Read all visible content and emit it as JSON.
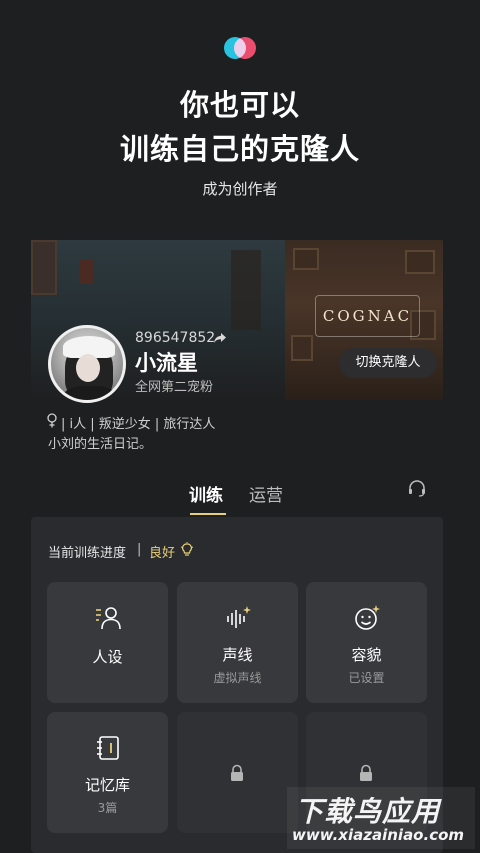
{
  "header": {
    "headline_line1": "你也可以",
    "headline_line2": "训练自己的克隆人",
    "subline": "成为创作者"
  },
  "profile": {
    "uid": "896547852",
    "nickname": "小流星",
    "subtitle": "全网第二宠粉",
    "tags": "| i人 | 叛逆少女 | 旅行达人",
    "bio": "小刘的生活日记。",
    "switch_label": "切换克隆人",
    "banner_sign": "COGNAC"
  },
  "tabs": [
    {
      "label": "训练",
      "active": true
    },
    {
      "label": "运营",
      "active": false
    }
  ],
  "progress": {
    "label": "当前训练进度",
    "separator": "|",
    "value": "良好"
  },
  "tiles": [
    {
      "label": "人设",
      "sub": "",
      "icon": "persona-icon",
      "locked": false
    },
    {
      "label": "声线",
      "sub": "虚拟声线",
      "icon": "voice-wave-icon",
      "locked": false
    },
    {
      "label": "容貌",
      "sub": "已设置",
      "icon": "face-sparkle-icon",
      "locked": false
    },
    {
      "label": "记忆库",
      "sub": "3篇",
      "icon": "notebook-icon",
      "locked": false
    },
    {
      "label": "",
      "sub": "",
      "icon": "lock-icon",
      "locked": true
    },
    {
      "label": "",
      "sub": "",
      "icon": "lock-icon",
      "locked": true
    }
  ],
  "watermark": {
    "title": "下载鸟应用",
    "url": "www.xiazainiao.com"
  },
  "colors": {
    "background": "#1e1f21",
    "panel": "#2a2b2e",
    "tile": "#38393c",
    "accent_gold": "#e8cf7a",
    "logo_cyan": "#27c3e0",
    "logo_pink": "#e8345a"
  }
}
